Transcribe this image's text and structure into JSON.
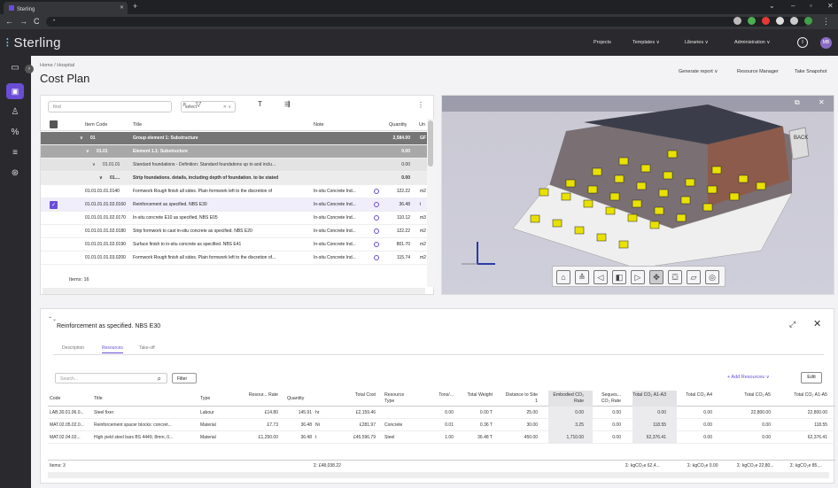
{
  "browser": {
    "tab_title": "Sterling",
    "url_placeholder": "•"
  },
  "app": {
    "logo": "Sterling",
    "nav": [
      "Projects",
      "Templates ∨",
      "Libraries ∨",
      "Administration ∨"
    ],
    "avatar_initials": "MB",
    "accent": "#6a4dd6"
  },
  "page": {
    "breadcrumb": "Home / Hospital",
    "title": "Cost Plan",
    "actions": [
      "Generate report ∨",
      "Resource Manager",
      "Take Snapshot"
    ]
  },
  "grid": {
    "find_placeholder": "find",
    "select_placeholder": "select",
    "columns": [
      "Item Code",
      "Title",
      "Note",
      "Quantity",
      "Un"
    ],
    "rows": [
      {
        "level": "g1",
        "code": "01",
        "title": "Group element 1: Substructure",
        "note": "",
        "qty": "2,584.00",
        "unit": "GF"
      },
      {
        "level": "g2",
        "code": "01.01",
        "title": "Element 1.1: Substructure",
        "note": "",
        "qty": "0.00",
        "unit": ""
      },
      {
        "level": "g3",
        "code": "01.01.01",
        "title": "Standard foundations - Definition: Standard foundations up to and inclu...",
        "note": "",
        "qty": "0.00",
        "unit": ""
      },
      {
        "level": "g4",
        "code": "01....",
        "title": "Strip foundations. details, including depth of foundation. to be stated",
        "note": "",
        "qty": "0.00",
        "unit": ""
      },
      {
        "level": "row",
        "code": "01.01.01.01.0140",
        "title": "Formwork Rough finish all sides. Plain formwork left to the discretion of",
        "note": "In-situ Concrete Ind...",
        "qty": "122.22",
        "unit": "m2"
      },
      {
        "level": "sel",
        "code": "01.01.01.01.02.0160",
        "title": "Reinforcement as specified. NBS E30",
        "note": "In-situ Concrete Ind...",
        "qty": "36.48",
        "unit": "t"
      },
      {
        "level": "row",
        "code": "01.01.01.01.02.0170",
        "title": "In-situ concrete E10 as specified, NBS E05",
        "note": "In-situ Concrete Ind...",
        "qty": "110.12",
        "unit": "m3"
      },
      {
        "level": "row",
        "code": "01.01.01.01.02.0180",
        "title": "Strip formwork to cast in-situ concrete as specified. NBS E20",
        "note": "In-situ Concrete Ind...",
        "qty": "122.22",
        "unit": "m2"
      },
      {
        "level": "row",
        "code": "01.01.01.01.02.0190",
        "title": "Surface finish to in-situ concrete as specified. NBS E41",
        "note": "In-situ Concrete Ind...",
        "qty": "801.70",
        "unit": "m2"
      },
      {
        "level": "row",
        "code": "01.01.01.01.03.0200",
        "title": "Formwork Rough finish all sides. Plain formwork left to the discretion of...",
        "note": "In-situ Concrete Ind...",
        "qty": "115.74",
        "unit": "m2"
      }
    ],
    "footer": "Items: 16"
  },
  "viewer": {
    "cube_label": "BACK",
    "tools": [
      "home-icon",
      "layers-icon",
      "arrow-left-icon",
      "cube-icon",
      "select-icon",
      "orbit-icon",
      "box-icon",
      "frame-icon",
      "camera-icon"
    ]
  },
  "detail": {
    "title": "Reinforcement as specified. NBS E30",
    "tabs": [
      "Description",
      "Resources",
      "Take-off"
    ],
    "active_tab": "Resources",
    "search_placeholder": "Search...",
    "filter_label": "Filter",
    "add_label": "+ Add Resources ∨",
    "edit_label": "Edit",
    "columns": [
      "Code",
      "Title",
      "Type",
      "Resour... Rate",
      "Quantity",
      "Total Cost",
      "Resource Type",
      "Tons/...",
      "Total Weight",
      "Distance to Site 1",
      "Embodied CO₂ Rate",
      "Seques... CO₂ Rate",
      "Total CO₂ A1-A3",
      "Total CO₂ A4",
      "Total CO₂ A5",
      "Total CO₂ A1-A5"
    ],
    "rows": [
      [
        "LAB.30.01.06.0...",
        "Steel fixer",
        "Labour",
        "£14.80",
        "145.91",
        "hr",
        "£2,159.46",
        "",
        "0.00",
        "0.00 T",
        "25.00",
        "0.00",
        "0.00",
        "0.00",
        "0.00",
        "22,800.00",
        "22,800.00"
      ],
      [
        "MAT.02.05.02.0...",
        "Reinforcement spacer blocks: concret...",
        "Material",
        "£7.73",
        "36.48",
        "Nr",
        "£281.97",
        "Concrete",
        "0.01",
        "0.36 T",
        "30.00",
        "3.25",
        "0.00",
        "118.55",
        "0.00",
        "0.00",
        "118.55"
      ],
      [
        "MAT.02.04.02...",
        "High yield steel bars BS 4449, 8mm, 0...",
        "Material",
        "£1,250.00",
        "36.48",
        "t",
        "£45,596.79",
        "Steel",
        "1.00",
        "36.48 T",
        "450.00",
        "1,710.00",
        "0.00",
        "62,376.41",
        "0.00",
        "0.00",
        "62,376.41"
      ]
    ],
    "footer": {
      "items": "Items: 3",
      "total_cost": "Σ: £48,038.22",
      "co2_a1a3": "Σ: kgCO₂e 62,4...",
      "co2_a4": "Σ: kgCO₂e 0.00",
      "co2_a5": "Σ: kgCO₂e 22,80...",
      "co2_total": "Σ: kgCO₂e 85,..."
    }
  }
}
